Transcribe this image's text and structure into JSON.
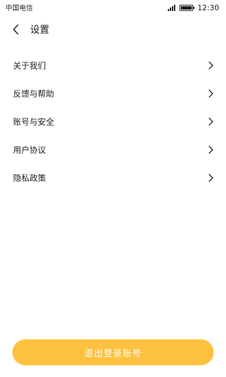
{
  "status_bar": {
    "carrier": "中国电信",
    "time": "12:30",
    "signal_icon": "signal-icon",
    "battery_icon": "battery-icon"
  },
  "header": {
    "back_icon": "chevron-left-icon",
    "title": "设置"
  },
  "menu": {
    "items": [
      {
        "label": "关于我们",
        "icon": "chevron-right-icon"
      },
      {
        "label": "反馈与帮助",
        "icon": "chevron-right-icon"
      },
      {
        "label": "账号与安全",
        "icon": "chevron-right-icon"
      },
      {
        "label": "用户协议",
        "icon": "chevron-right-icon"
      },
      {
        "label": "隐私政策",
        "icon": "chevron-right-icon"
      }
    ]
  },
  "logout": {
    "label": "退出登录账号",
    "color": "#fec13f"
  }
}
